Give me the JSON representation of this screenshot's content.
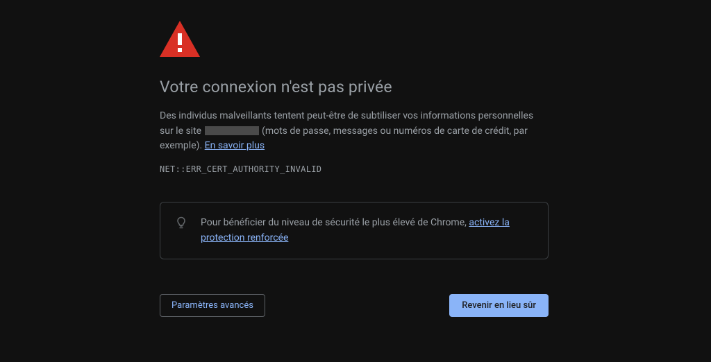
{
  "heading": "Votre connexion n'est pas privée",
  "description": {
    "part1": "Des individus malveillants tentent peut-être de subtiliser vos informations personnelles sur le site ",
    "part2": " (mots de passe, messages ou numéros de carte de crédit, par exemple). ",
    "learn_more": "En savoir plus"
  },
  "error_code": "NET::ERR_CERT_AUTHORITY_INVALID",
  "tip": {
    "text": "Pour bénéficier du niveau de sécurité le plus élevé de Chrome, ",
    "link": "activez la protection renforcée"
  },
  "buttons": {
    "advanced": "Paramètres avancés",
    "back_to_safety": "Revenir en lieu sûr"
  },
  "colors": {
    "danger": "#d93025",
    "link": "#8ab4f8",
    "text": "#9aa0a6",
    "background": "#111111"
  }
}
